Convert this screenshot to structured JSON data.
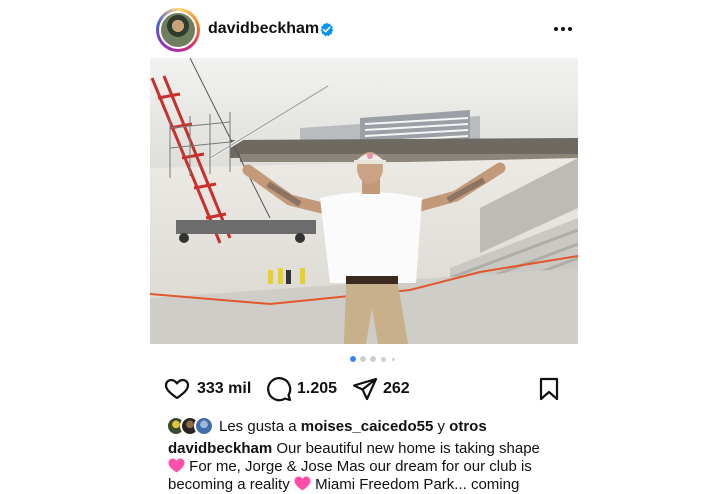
{
  "post": {
    "username": "davidbeckham",
    "verified": true,
    "more_icon": "more-horizontal-icon"
  },
  "carousel": {
    "count": 5,
    "active_index": 0
  },
  "actions": {
    "like_count": "333 mil",
    "comment_count": "1.205",
    "share_count": "262"
  },
  "likes": {
    "prefix": "Les gusta a",
    "user": "moises_caicedo55",
    "conjunction": "y",
    "others": "otros"
  },
  "caption": {
    "author": "davidbeckham",
    "line1": "Our beautiful new home is taking shape",
    "line2": "For me, Jorge & Jose Mas our dream for our club is",
    "line3a": "becoming a reality",
    "line3b": "Miami Freedom Park... coming"
  },
  "colors": {
    "verified_blue": "#0095f6",
    "dot_active": "#3b82f6",
    "heart_emoji": "#ff4fa8"
  }
}
